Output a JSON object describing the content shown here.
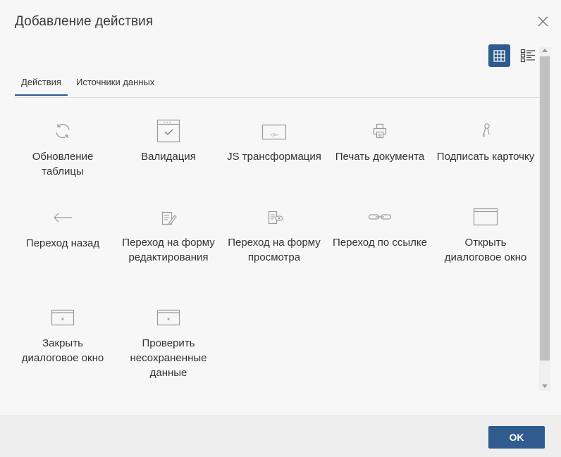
{
  "dialog": {
    "title": "Добавление действия",
    "ok_label": "OK"
  },
  "tabs": [
    {
      "label": "Действия",
      "active": true
    },
    {
      "label": "Источники данных",
      "active": false
    }
  ],
  "view_modes": {
    "active": "grid"
  },
  "colors": {
    "accent": "#2f5b8e",
    "icon": "#9a9a9a"
  },
  "actions": [
    {
      "label": "Обновление таблицы",
      "icon": "refresh-icon"
    },
    {
      "label": "Валидация",
      "icon": "validation-window-icon"
    },
    {
      "label": "JS трансформация",
      "icon": "js-window-icon"
    },
    {
      "label": "Печать документа",
      "icon": "printer-icon"
    },
    {
      "label": "Подписать карточку",
      "icon": "key-sign-icon"
    },
    {
      "label": "Переход назад",
      "icon": "arrow-left-icon"
    },
    {
      "label": "Переход на форму редактирования",
      "icon": "edit-form-icon"
    },
    {
      "label": "Переход на форму просмотра",
      "icon": "view-form-icon"
    },
    {
      "label": "Переход по ссылке",
      "icon": "link-icon"
    },
    {
      "label": "Открыть диалоговое окно",
      "icon": "open-window-icon"
    },
    {
      "label": "Закрыть диалоговое окно",
      "icon": "close-window-icon"
    },
    {
      "label": "Проверить несохраненные данные",
      "icon": "check-unsaved-window-icon"
    }
  ]
}
